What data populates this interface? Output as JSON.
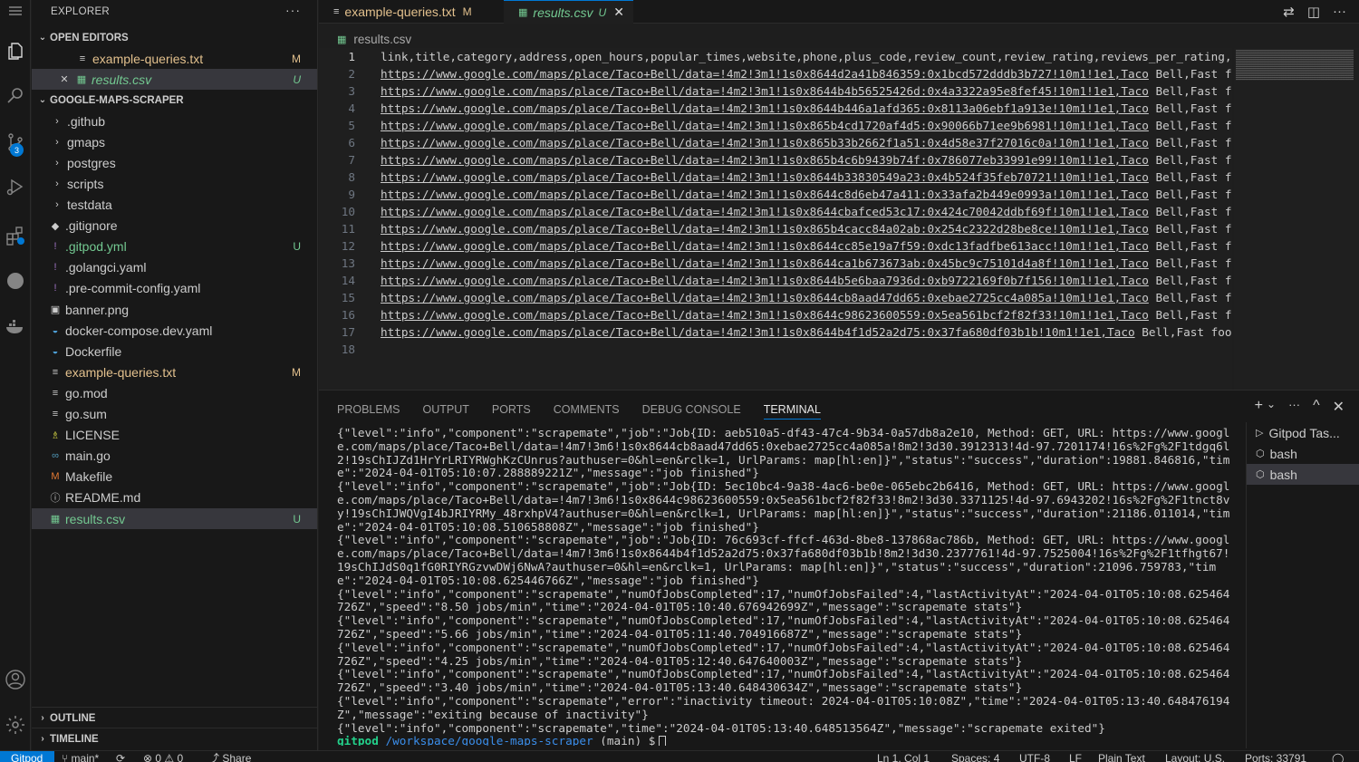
{
  "explorer": {
    "title": "EXPLORER",
    "more": "···",
    "open_editors_label": "OPEN EDITORS",
    "open_editors": [
      {
        "name": "example-queries.txt",
        "status": "M",
        "icon": "≡",
        "close": ""
      },
      {
        "name": "results.csv",
        "status": "U",
        "icon": "▦",
        "close": "✕"
      }
    ],
    "project_label": "GOOGLE-MAPS-SCRAPER",
    "tree": [
      {
        "name": ".github",
        "kind": "folder",
        "icon": "›",
        "status": ""
      },
      {
        "name": "gmaps",
        "kind": "folder",
        "icon": "›",
        "status": ""
      },
      {
        "name": "postgres",
        "kind": "folder",
        "icon": "›",
        "status": ""
      },
      {
        "name": "scripts",
        "kind": "folder",
        "icon": "›",
        "status": ""
      },
      {
        "name": "testdata",
        "kind": "folder",
        "icon": "›",
        "status": ""
      },
      {
        "name": ".gitignore",
        "kind": "file",
        "icon": "◆",
        "status": ""
      },
      {
        "name": ".gitpod.yml",
        "kind": "file",
        "icon": "!",
        "status": "U"
      },
      {
        "name": ".golangci.yaml",
        "kind": "file",
        "icon": "!",
        "status": ""
      },
      {
        "name": ".pre-commit-config.yaml",
        "kind": "file",
        "icon": "!",
        "status": ""
      },
      {
        "name": "banner.png",
        "kind": "file",
        "icon": "▣",
        "status": ""
      },
      {
        "name": "docker-compose.dev.yaml",
        "kind": "file",
        "icon": "◒",
        "status": ""
      },
      {
        "name": "Dockerfile",
        "kind": "file",
        "icon": "◒",
        "status": ""
      },
      {
        "name": "example-queries.txt",
        "kind": "file",
        "icon": "≡",
        "status": "M"
      },
      {
        "name": "go.mod",
        "kind": "file",
        "icon": "≡",
        "status": ""
      },
      {
        "name": "go.sum",
        "kind": "file",
        "icon": "≡",
        "status": ""
      },
      {
        "name": "LICENSE",
        "kind": "file",
        "icon": "♗",
        "status": ""
      },
      {
        "name": "main.go",
        "kind": "file",
        "icon": "∞",
        "status": ""
      },
      {
        "name": "Makefile",
        "kind": "file",
        "icon": "M",
        "status": ""
      },
      {
        "name": "README.md",
        "kind": "file",
        "icon": "ⓘ",
        "status": ""
      },
      {
        "name": "results.csv",
        "kind": "file",
        "icon": "▦",
        "status": "U"
      }
    ],
    "outline_label": "OUTLINE",
    "timeline_label": "TIMELINE"
  },
  "tabs": [
    {
      "name": "example-queries.txt",
      "status": "M",
      "icon": "≡"
    },
    {
      "name": "results.csv",
      "status": "U",
      "icon": "▦",
      "close": "✕"
    }
  ],
  "breadcrumb": {
    "icon": "▦",
    "file": "results.csv"
  },
  "editor": {
    "lines": [
      {
        "n": "1",
        "url": "",
        "text": "link,title,category,address,open_hours,popular_times,website,phone,plus_code,review_count,review_rating,reviews_per_rating,"
      },
      {
        "n": "2",
        "url": "https://www.google.com/maps/place/Taco+Bell/data=!4m2!3m1!1s0x8644d2a41b846359:0x1bcd572dddb3b727!10m1!1e1,Taco",
        "text": " Bell,Fast fo"
      },
      {
        "n": "3",
        "url": "https://www.google.com/maps/place/Taco+Bell/data=!4m2!3m1!1s0x8644b4b56525426d:0x4a3322a95e8fef45!10m1!1e1,Taco",
        "text": " Bell,Fast fo"
      },
      {
        "n": "4",
        "url": "https://www.google.com/maps/place/Taco+Bell/data=!4m2!3m1!1s0x8644b446a1afd365:0x8113a06ebf1a913e!10m1!1e1,Taco",
        "text": " Bell,Fast fo"
      },
      {
        "n": "5",
        "url": "https://www.google.com/maps/place/Taco+Bell/data=!4m2!3m1!1s0x865b4cd1720af4d5:0x90066b71ee9b6981!10m1!1e1,Taco",
        "text": " Bell,Fast fo"
      },
      {
        "n": "6",
        "url": "https://www.google.com/maps/place/Taco+Bell/data=!4m2!3m1!1s0x865b33b2662f1a51:0x4d58e37f27016c0a!10m1!1e1,Taco",
        "text": " Bell,Fast fo"
      },
      {
        "n": "7",
        "url": "https://www.google.com/maps/place/Taco+Bell/data=!4m2!3m1!1s0x865b4c6b9439b74f:0x786077eb33991e99!10m1!1e1,Taco",
        "text": " Bell,Fast fo"
      },
      {
        "n": "8",
        "url": "https://www.google.com/maps/place/Taco+Bell/data=!4m2!3m1!1s0x8644b33830549a23:0x4b524f35feb70721!10m1!1e1,Taco",
        "text": " Bell,Fast fo"
      },
      {
        "n": "9",
        "url": "https://www.google.com/maps/place/Taco+Bell/data=!4m2!3m1!1s0x8644c8d6eb47a411:0x33afa2b449e0993a!10m1!1e1,Taco",
        "text": " Bell,Fast fo"
      },
      {
        "n": "10",
        "url": "https://www.google.com/maps/place/Taco+Bell/data=!4m2!3m1!1s0x8644cbafced53c17:0x424c70042ddbf69f!10m1!1e1,Taco",
        "text": " Bell,Fast fo"
      },
      {
        "n": "11",
        "url": "https://www.google.com/maps/place/Taco+Bell/data=!4m2!3m1!1s0x865b4cacc84a02ab:0x254c2322d28be8ce!10m1!1e1,Taco",
        "text": " Bell,Fast fo"
      },
      {
        "n": "12",
        "url": "https://www.google.com/maps/place/Taco+Bell/data=!4m2!3m1!1s0x8644cc85e19a7f59:0xdc13fadfbe613acc!10m1!1e1,Taco",
        "text": " Bell,Fast fo"
      },
      {
        "n": "13",
        "url": "https://www.google.com/maps/place/Taco+Bell/data=!4m2!3m1!1s0x8644ca1b673673ab:0x45bc9c75101d4a8f!10m1!1e1,Taco",
        "text": " Bell,Fast fo"
      },
      {
        "n": "14",
        "url": "https://www.google.com/maps/place/Taco+Bell/data=!4m2!3m1!1s0x8644b5e6baa7936d:0xb9722169f0b7f156!10m1!1e1,Taco",
        "text": " Bell,Fast fo"
      },
      {
        "n": "15",
        "url": "https://www.google.com/maps/place/Taco+Bell/data=!4m2!3m1!1s0x8644cb8aad47dd65:0xebae2725cc4a085a!10m1!1e1,Taco",
        "text": " Bell,Fast fo"
      },
      {
        "n": "16",
        "url": "https://www.google.com/maps/place/Taco+Bell/data=!4m2!3m1!1s0x8644c98623600559:0x5ea561bcf2f82f33!10m1!1e1,Taco",
        "text": " Bell,Fast fo"
      },
      {
        "n": "17",
        "url": "https://www.google.com/maps/place/Taco+Bell/data=!4m2!3m1!1s0x8644b4f1d52a2d75:0x37fa680df03b1b!10m1!1e1,Taco",
        "text": " Bell,Fast food"
      },
      {
        "n": "18",
        "url": "",
        "text": ""
      }
    ]
  },
  "panel": {
    "tabs": [
      "PROBLEMS",
      "OUTPUT",
      "PORTS",
      "COMMENTS",
      "DEBUG CONSOLE",
      "TERMINAL"
    ],
    "active_tab": "TERMINAL",
    "actions": [
      "+",
      "⌄",
      "···",
      "^",
      "✕"
    ],
    "terminal_lines": [
      "{\"level\":\"info\",\"component\":\"scrapemate\",\"job\":\"Job{ID: aeb510a5-df43-47c4-9b34-0a57db8a2e10, Method: GET, URL: https://www.google.com/maps/place/Taco+Bell/data=!4m7!3m6!1s0x8644cb8aad47dd65:0xebae2725cc4a085a!8m2!3d30.3912313!4d-97.7201174!16s%2Fg%2F1tdgq6l2!19sChIJZd1HrYrLRIYRWghKzCUnrus?authuser=0&hl=en&rclk=1, UrlParams: map[hl:en]}\",\"status\":\"success\",\"duration\":19881.846816,\"time\":\"2024-04-01T05:10:07.288889221Z\",\"message\":\"job finished\"}",
      "{\"level\":\"info\",\"component\":\"scrapemate\",\"job\":\"Job{ID: 5ec10bc4-9a38-4ac6-be0e-065ebc2b6416, Method: GET, URL: https://www.google.com/maps/place/Taco+Bell/data=!4m7!3m6!1s0x8644c98623600559:0x5ea561bcf2f82f33!8m2!3d30.3371125!4d-97.6943202!16s%2Fg%2F1tnct8vy!19sChIJWQVgI4bJRIYRMy_48rxhpV4?authuser=0&hl=en&rclk=1, UrlParams: map[hl:en]}\",\"status\":\"success\",\"duration\":21186.011014,\"time\":\"2024-04-01T05:10:08.510658808Z\",\"message\":\"job finished\"}",
      "{\"level\":\"info\",\"component\":\"scrapemate\",\"job\":\"Job{ID: 76c693cf-ffcf-463d-8be8-137868ac786b, Method: GET, URL: https://www.google.com/maps/place/Taco+Bell/data=!4m7!3m6!1s0x8644b4f1d52a2d75:0x37fa680df03b1b!8m2!3d30.2377761!4d-97.7525004!16s%2Fg%2F1tfhgt67!19sChIJdS0q1fG0RIYRGzvwDWj6NwA?authuser=0&hl=en&rclk=1, UrlParams: map[hl:en]}\",\"status\":\"success\",\"duration\":21096.759783,\"time\":\"2024-04-01T05:10:08.625446766Z\",\"message\":\"job finished\"}",
      "{\"level\":\"info\",\"component\":\"scrapemate\",\"numOfJobsCompleted\":17,\"numOfJobsFailed\":4,\"lastActivityAt\":\"2024-04-01T05:10:08.625464726Z\",\"speed\":\"8.50 jobs/min\",\"time\":\"2024-04-01T05:10:40.676942699Z\",\"message\":\"scrapemate stats\"}",
      "{\"level\":\"info\",\"component\":\"scrapemate\",\"numOfJobsCompleted\":17,\"numOfJobsFailed\":4,\"lastActivityAt\":\"2024-04-01T05:10:08.625464726Z\",\"speed\":\"5.66 jobs/min\",\"time\":\"2024-04-01T05:11:40.704916687Z\",\"message\":\"scrapemate stats\"}",
      "{\"level\":\"info\",\"component\":\"scrapemate\",\"numOfJobsCompleted\":17,\"numOfJobsFailed\":4,\"lastActivityAt\":\"2024-04-01T05:10:08.625464726Z\",\"speed\":\"4.25 jobs/min\",\"time\":\"2024-04-01T05:12:40.647640003Z\",\"message\":\"scrapemate stats\"}",
      "{\"level\":\"info\",\"component\":\"scrapemate\",\"numOfJobsCompleted\":17,\"numOfJobsFailed\":4,\"lastActivityAt\":\"2024-04-01T05:10:08.625464726Z\",\"speed\":\"3.40 jobs/min\",\"time\":\"2024-04-01T05:13:40.648430634Z\",\"message\":\"scrapemate stats\"}",
      "{\"level\":\"info\",\"component\":\"scrapemate\",\"error\":\"inactivity timeout: 2024-04-01T05:10:08Z\",\"time\":\"2024-04-01T05:13:40.648476194Z\",\"message\":\"exiting because of inactivity\"}",
      "{\"level\":\"info\",\"component\":\"scrapemate\",\"time\":\"2024-04-01T05:13:40.648513564Z\",\"message\":\"scrapemate exited\"}"
    ],
    "prompt": {
      "user": "gitpod",
      "path": "/workspace/google-maps-scraper",
      "branch": "(main) $"
    },
    "terminals": [
      "Gitpod Tas...",
      "bash",
      "bash"
    ]
  },
  "statusbar": {
    "remote": "Gitpod",
    "branch": "main*",
    "sync": "⟳",
    "problems": "⊗ 0 ⚠ 0",
    "share": "Share",
    "position": "Ln 1, Col 1",
    "spaces": "Spaces: 4",
    "encoding": "UTF-8",
    "eol": "LF",
    "language": "Plain Text",
    "layout": "Layout: U.S.",
    "ports": "Ports: 33791"
  },
  "activity": {
    "scm_badge": "3"
  },
  "colors": {
    "accent": "#0078d4",
    "modified": "#e2c08d",
    "untracked": "#73c991"
  }
}
